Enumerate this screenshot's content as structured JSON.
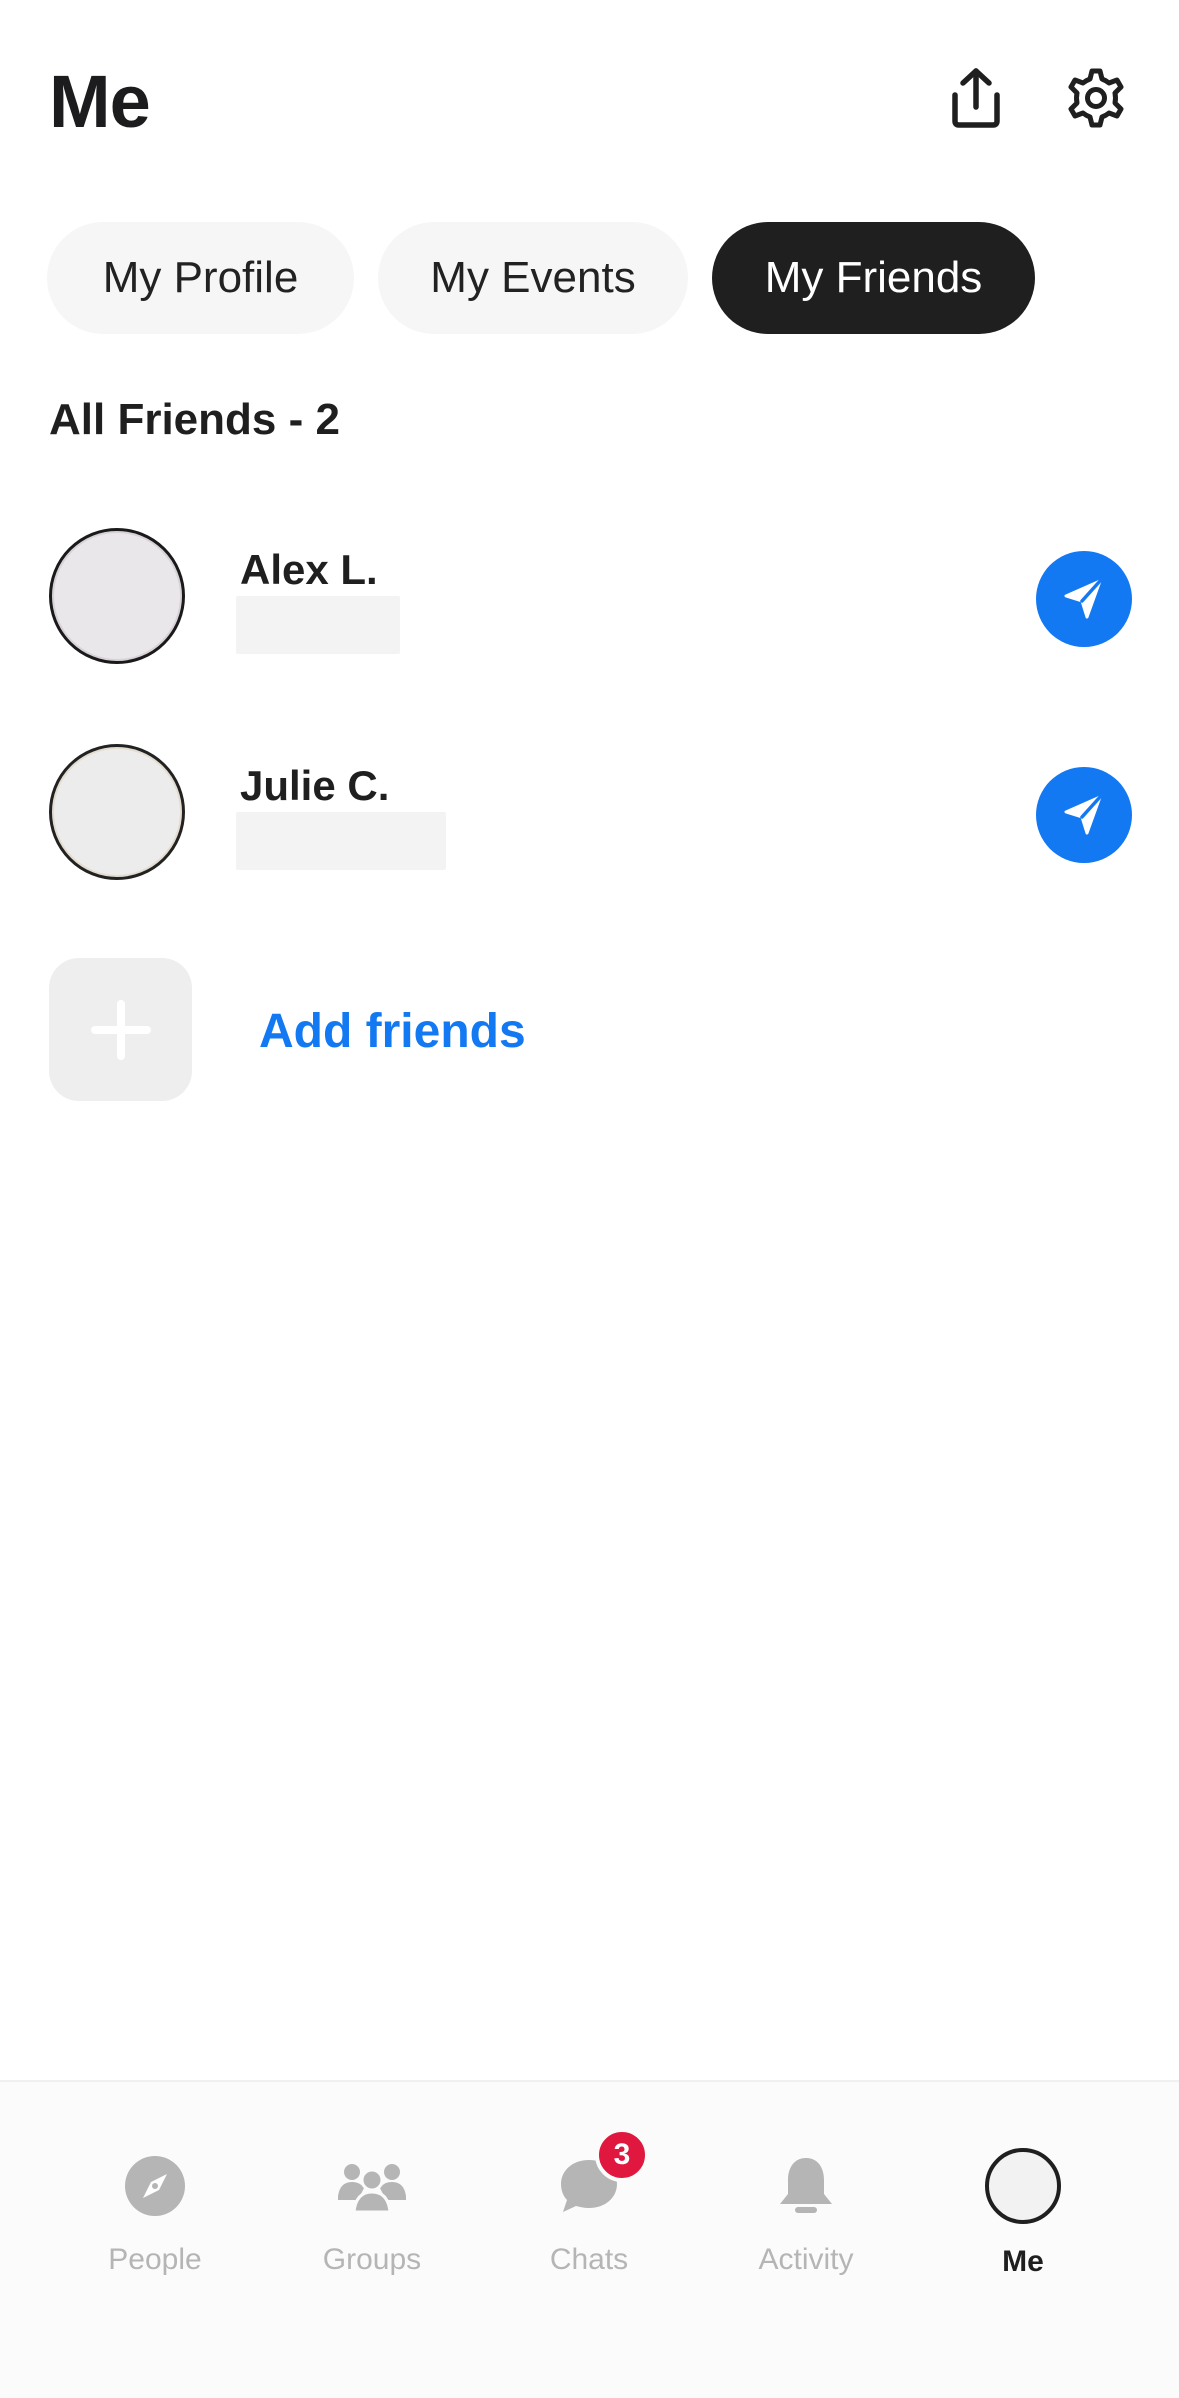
{
  "header": {
    "title": "Me",
    "share_icon": "share-icon",
    "settings_icon": "gear-icon"
  },
  "tabs": [
    {
      "label": "My Profile",
      "active": false
    },
    {
      "label": "My Events",
      "active": false
    },
    {
      "label": "My Friends",
      "active": true
    }
  ],
  "friends_section": {
    "title": "All Friends - 2",
    "friends": [
      {
        "name": "Alex L."
      },
      {
        "name": "Julie C."
      }
    ],
    "add_label": "Add friends"
  },
  "colors": {
    "accent": "#1379f3",
    "active_tab_bg": "#1f1f1f",
    "badge": "#e0173f"
  },
  "bottom_nav": {
    "items": [
      {
        "label": "People",
        "icon": "compass-icon"
      },
      {
        "label": "Groups",
        "icon": "groups-icon"
      },
      {
        "label": "Chats",
        "icon": "chat-bubble-icon",
        "badge": "3"
      },
      {
        "label": "Activity",
        "icon": "bell-icon"
      },
      {
        "label": "Me",
        "icon": "avatar",
        "active": true
      }
    ]
  }
}
